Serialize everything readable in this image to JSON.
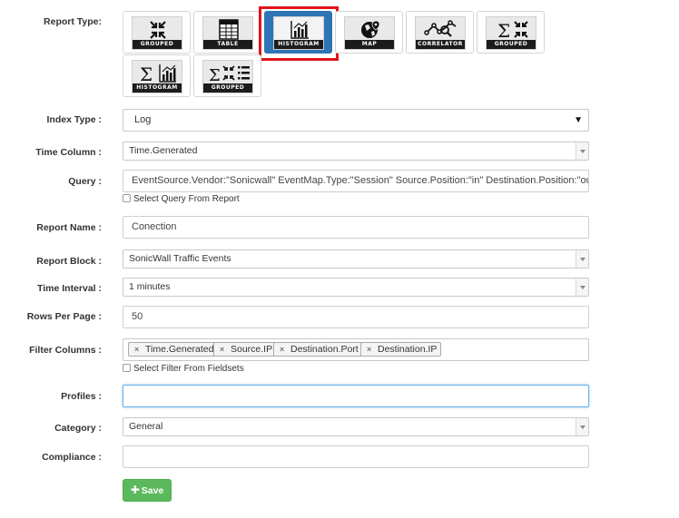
{
  "report_type": {
    "label": "Report Type:",
    "tiles": [
      {
        "caption": "GROUPED",
        "icon": "grouped-icon"
      },
      {
        "caption": "TABLE",
        "icon": "table-icon"
      },
      {
        "caption": "HISTOGRAM",
        "icon": "histogram-icon",
        "selected": true
      },
      {
        "caption": "MAP",
        "icon": "map-icon"
      },
      {
        "caption": "CORRELATOR",
        "icon": "correlator-icon"
      },
      {
        "caption": "GROUPED",
        "icon": "sum-grouped-icon"
      },
      {
        "caption": "HISTOGRAM",
        "icon": "sum-histogram-icon"
      },
      {
        "caption": "GROUPED",
        "icon": "sum-grouped-list-icon"
      }
    ]
  },
  "index_type": {
    "label": "Index Type :",
    "value": "Log"
  },
  "time_column": {
    "label": "Time Column :",
    "value": "Time.Generated"
  },
  "query": {
    "label": "Query :",
    "value": "EventSource.Vendor:\"Sonicwall\" EventMap.Type:\"Session\" Source.Position:\"in\" Destination.Position:\"out\"",
    "checkbox_label": "Select Query From Report"
  },
  "report_name": {
    "label": "Report Name :",
    "value": "Conection"
  },
  "report_block": {
    "label": "Report Block :",
    "value": "SonicWall Traffic Events"
  },
  "time_interval": {
    "label": "Time Interval :",
    "value": "1 minutes"
  },
  "rows_per_page": {
    "label": "Rows Per Page :",
    "value": "50"
  },
  "filter_columns": {
    "label": "Filter Columns :",
    "tags": [
      "Time.Generated",
      "Source.IP",
      "Destination.Port",
      "Destination.IP"
    ],
    "checkbox_label": "Select Filter From Fieldsets"
  },
  "profiles": {
    "label": "Profiles :",
    "value": ""
  },
  "category": {
    "label": "Category :",
    "value": "General"
  },
  "compliance": {
    "label": "Compliance :",
    "value": ""
  },
  "save_button": {
    "label": "Save"
  },
  "colors": {
    "accent": "#2e75b6",
    "highlight": "#e0141b",
    "save": "#5cb85c"
  }
}
